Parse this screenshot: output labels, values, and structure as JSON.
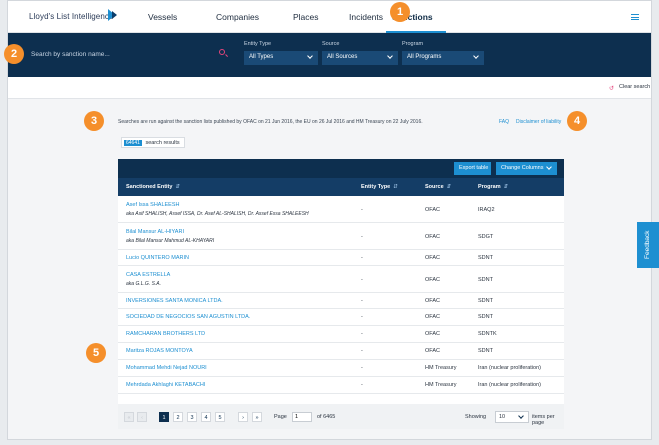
{
  "nav": {
    "logo": "Lloyd's List Intelligence",
    "items": [
      "Vessels",
      "Companies",
      "Places",
      "Incidents",
      "Sanctions"
    ],
    "active": "Sanctions"
  },
  "search": {
    "placeholder": "Search by sanction name..."
  },
  "filters": {
    "entity_type": {
      "label": "Entity Type",
      "value": "All Types"
    },
    "source": {
      "label": "Source",
      "value": "All Sources"
    },
    "program": {
      "label": "Program",
      "value": "All Programs"
    }
  },
  "clear_search": "Clear search",
  "info": {
    "text": "Searches are run against the sanction lists published by OFAC on 21 Jun 2016, the EU on 26 Jul 2016 and HM Treasury on 22 July 2016.",
    "faq": "FAQ",
    "disclaimer": "Disclaimer of liability"
  },
  "results": {
    "count": "64641",
    "label": "search results"
  },
  "table": {
    "export_label": "Export table",
    "change_columns_label": "Change Columns",
    "headers": {
      "entity": "Sanctioned Entity",
      "type": "Entity Type",
      "source": "Source",
      "program": "Program"
    },
    "sort_glyph": "⇵",
    "rows": [
      {
        "name": "Asef Issa SHALEESH",
        "aka": "aka Asif SHALISH, Assef ISSA, Dr. Asef AL-SHALISH, Dr. Assef Essa SHALEESH",
        "type": "-",
        "source": "OFAC",
        "program": "IRAQ2"
      },
      {
        "name": "Bilal Mansur AL-HIYARI",
        "aka": "aka Bilal Mansur Mahmud AL-KHAYARI",
        "type": "-",
        "source": "OFAC",
        "program": "SDGT"
      },
      {
        "name": "Lucio QUINTERO MARIN",
        "aka": "",
        "type": "-",
        "source": "OFAC",
        "program": "SDNT"
      },
      {
        "name": "CASA ESTRELLA",
        "aka": "aka G.L.G. S.A.",
        "type": "-",
        "source": "OFAC",
        "program": "SDNT"
      },
      {
        "name": "INVERSIONES SANTA MONICA LTDA.",
        "aka": "",
        "type": "-",
        "source": "OFAC",
        "program": "SDNT"
      },
      {
        "name": "SOCIEDAD DE NEGOCIOS SAN AGUSTIN LTDA.",
        "aka": "",
        "type": "-",
        "source": "OFAC",
        "program": "SDNT"
      },
      {
        "name": "RAMCHARAN BROTHERS LTD",
        "aka": "",
        "type": "-",
        "source": "OFAC",
        "program": "SDNTK"
      },
      {
        "name": "Maritza ROJAS MONTOYA",
        "aka": "",
        "type": "-",
        "source": "OFAC",
        "program": "SDNT"
      },
      {
        "name": "Mohammad Mehdi Nejad NOURI",
        "aka": "",
        "type": "-",
        "source": "HM Treasury",
        "program": "Iran (nuclear proliferation)"
      },
      {
        "name": "Mehrdada Akhlaghi KETABACHI",
        "aka": "",
        "type": "-",
        "source": "HM Treasury",
        "program": "Iran (nuclear proliferation)"
      }
    ]
  },
  "pagination": {
    "first": "«",
    "prev": "‹",
    "next": "›",
    "last": "»",
    "pages": [
      "1",
      "2",
      "3",
      "4",
      "5"
    ],
    "page_label": "Page",
    "current_page": "1",
    "of_label": "of 6465",
    "showing_label": "Showing",
    "per_page_value": "10",
    "per_page_label": "items per page"
  },
  "markers": [
    "1",
    "2",
    "3",
    "4",
    "5"
  ],
  "feedback": "Feedback",
  "colors": {
    "navy": "#0d2f4f",
    "accent": "#1d8fd1",
    "marker": "#f58f2b",
    "pink": "#e4447b"
  }
}
